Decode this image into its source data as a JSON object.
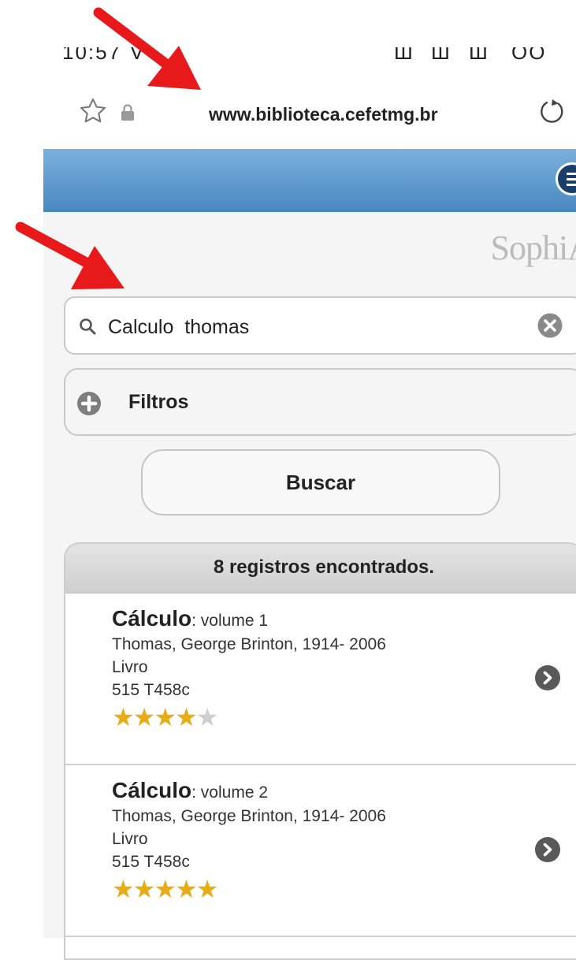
{
  "browser": {
    "url": "www.biblioteca.cefetmg.br",
    "status_fragments": [
      "10:57",
      "V",
      "Ш",
      "Ш",
      "Ш",
      "OO"
    ]
  },
  "app": {
    "logo": "SophiA",
    "search": {
      "value": "Calculo  thomas"
    },
    "filters_label": "Filtros",
    "search_button": "Buscar"
  },
  "results": {
    "header": "8 registros encontrados.",
    "items": [
      {
        "title": "Cálculo",
        "subtitle": ": volume 1",
        "author": "Thomas, George Brinton, 1914- 2006",
        "type": "Livro",
        "call_number": "515 T458c",
        "rating": 4,
        "rating_max": 5
      },
      {
        "title": "Cálculo",
        "subtitle": ": volume 2",
        "author": "Thomas, George Brinton, 1914- 2006",
        "type": "Livro",
        "call_number": "515 T458c",
        "rating": 5,
        "rating_max": 5
      }
    ]
  },
  "colors": {
    "header_top": "#7ab0dc",
    "header_bottom": "#4a88c0",
    "star": "#e8ad16",
    "star_empty": "#cfcfcf",
    "arrow": "#e8191a"
  }
}
